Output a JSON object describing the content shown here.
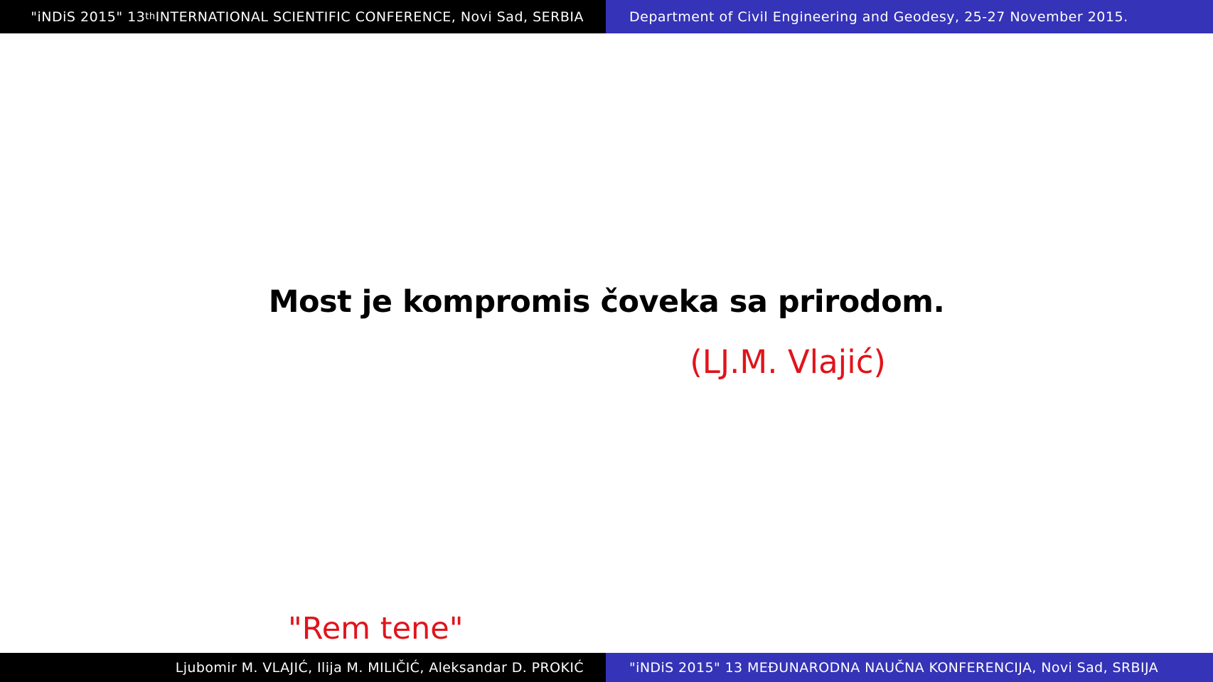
{
  "header": {
    "left_prefix": "\"iNDiS 2015\" 13",
    "left_sup": "th",
    "left_suffix": " INTERNATIONAL SCIENTIFIC CONFERENCE, Novi Sad, SERBIA",
    "right": "Department of Civil Engineering and Geodesy, 25-27 November 2015."
  },
  "slide": {
    "quote": "Most je kompromis čoveka sa prirodom.",
    "author": "(LJ.M. Vlajić)",
    "motto": "\"Rem tene\""
  },
  "footer": {
    "left": "Ljubomir M. VLAJIĆ, Ilija M. MILIČIĆ, Aleksandar D. PROKIĆ",
    "right": "\"iNDiS 2015\" 13 MEĐUNARODNA NAUČNA KONFERENCIJA, Novi Sad, SRBIJA"
  },
  "colors": {
    "bar_black": "#000000",
    "bar_blue": "#3533b7",
    "accent_red": "#e0141b"
  }
}
